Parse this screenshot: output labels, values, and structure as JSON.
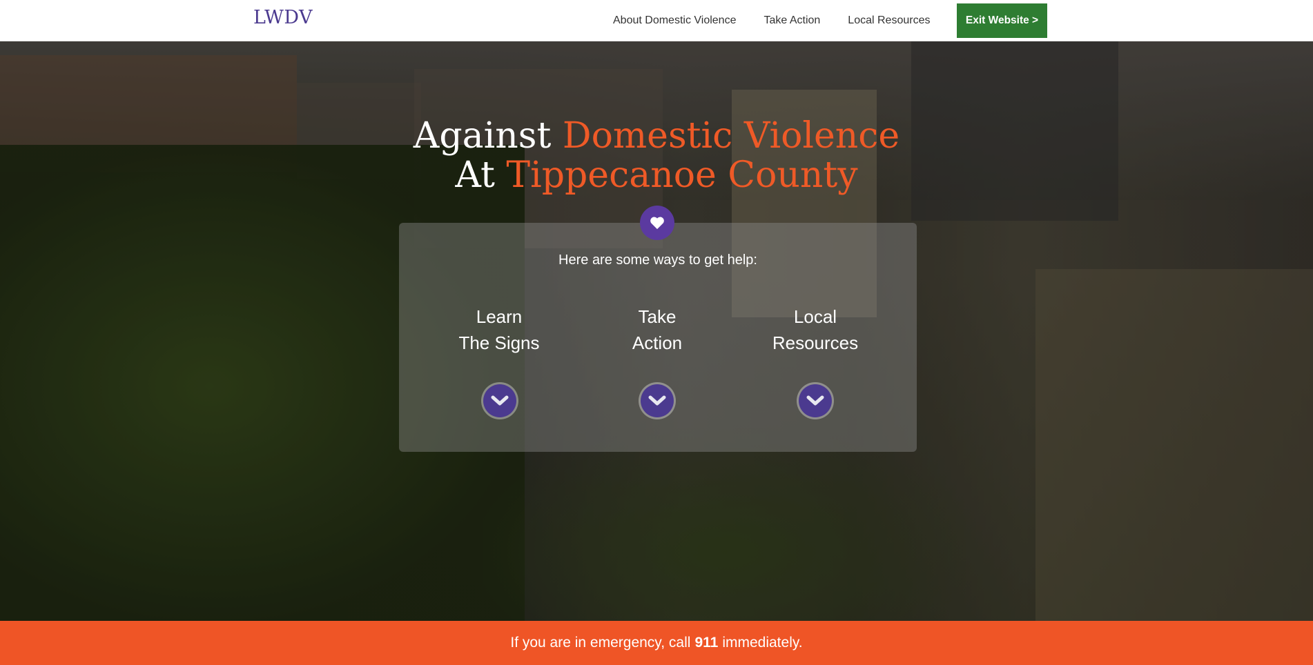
{
  "header": {
    "logo": "LWDV",
    "nav": [
      {
        "label": "About Domestic Violence"
      },
      {
        "label": "Take Action"
      },
      {
        "label": "Local Resources"
      }
    ],
    "exit_label": "Exit Website >",
    "exit_color": "#2e7d32"
  },
  "hero": {
    "line1_plain": "Against",
    "line1_accent": "Domestic Violence",
    "line2_plain": "At",
    "line2_accent": "Tippecanoe County",
    "accent_color": "#ef5a27",
    "panel_subtitle": "Here are some ways to get help:",
    "options": [
      {
        "line1": "Learn",
        "line2": "The Signs",
        "icon": "chevron-down-icon"
      },
      {
        "line1": "Take",
        "line2": "Action",
        "icon": "chevron-down-icon"
      },
      {
        "line1": "Local",
        "line2": "Resources",
        "icon": "chevron-down-icon"
      }
    ],
    "heart_icon": "heart-icon",
    "brand_purple": "#4b3a8f"
  },
  "emergency": {
    "before": "If you are in emergency, call",
    "number": "911",
    "after": "immediately.",
    "color": "#ef5526"
  }
}
